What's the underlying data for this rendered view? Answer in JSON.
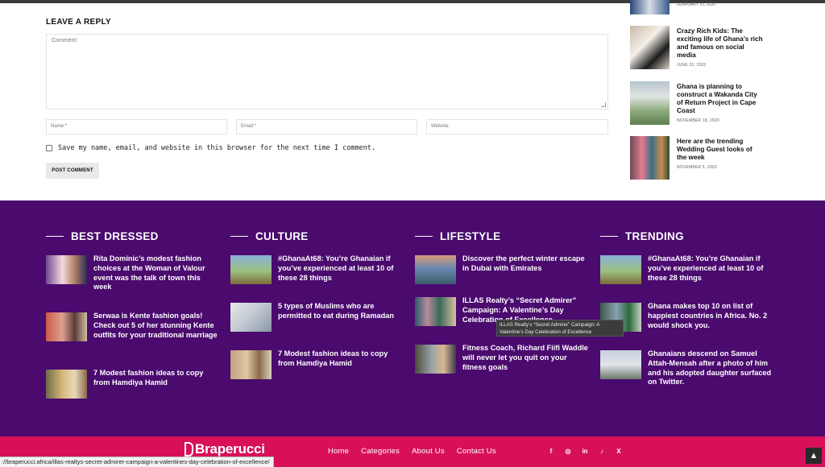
{
  "reply": {
    "heading": "LEAVE A REPLY",
    "comment_placeholder": "Comment:",
    "name_placeholder": "Name:*",
    "email_placeholder": "Email:*",
    "website_placeholder": "Website:",
    "consent_text": "Save my name, email, and website in this browser for the next time I comment.",
    "submit_label": "POST COMMENT"
  },
  "sidebar": {
    "top_date": "FEBRUARY 16, 2020",
    "items": [
      {
        "title": "Crazy Rich Kids: The exciting life of Ghana’s rich and famous on social media",
        "date": "JUNE 22, 2020"
      },
      {
        "title": "Ghana is planning to construct a Wakanda City of Return Project in Cape Coast",
        "date": "NOVEMBER 18, 2020"
      },
      {
        "title": "Here are the trending Wedding Guest looks of the week",
        "date": "NOVEMBER 6, 2020"
      }
    ]
  },
  "columns": [
    {
      "heading": "BEST DRESSED",
      "posts": [
        "Rita Dominic’s modest fashion choices at the Woman of Valour event was the talk of town this week",
        "Serwaa is Kente fashion goals! Check out 5 of her stunning Kente outfits for your traditional marriage",
        "7 Modest fashion ideas to copy from Hamdiya Hamid"
      ]
    },
    {
      "heading": "CULTURE",
      "posts": [
        "#GhanaAt68: You’re Ghanaian if you’ve experienced at least 10 of these 28 things",
        "5 types of Muslims who are permitted to eat during Ramadan",
        "7 Modest fashion ideas to copy from Hamdiya Hamid"
      ]
    },
    {
      "heading": "LIFESTYLE",
      "posts": [
        "Discover the perfect winter escape in Dubai with Emirates",
        "ILLAS Realty’s “Secret Admirer” Campaign: A Valentine’s Day Celebration of Excellence",
        "Fitness Coach, Richard Fiifi Waddle will never let you quit on your fitness goals"
      ]
    },
    {
      "heading": "TRENDING",
      "posts": [
        "#GhanaAt68: You’re Ghanaian if you’ve experienced at least 10 of these 28 things",
        "Ghana makes top 10 on list of happiest countries in Africa. No. 2 would shock you.",
        "Ghanaians descend on Samuel Attah-Mensah after a photo of him and his adopted daughter surfaced on Twitter."
      ]
    }
  ],
  "tooltip": "ILLAS Realty’s “Secret Admirer” Campaign: A Valentine’s Day Celebration of Excellence",
  "footer": {
    "logo": "Braperucci",
    "nav": [
      "Home",
      "Categories",
      "About Us",
      "Contact Us"
    ],
    "social": [
      "f",
      "◎",
      "in",
      "♪",
      "X"
    ],
    "to_top": "▲"
  },
  "statusbar_url": "://braperucci.africa/illas-realtys-secret-admirer-campaign-a-valentines-day-celebration-of-excellence/"
}
